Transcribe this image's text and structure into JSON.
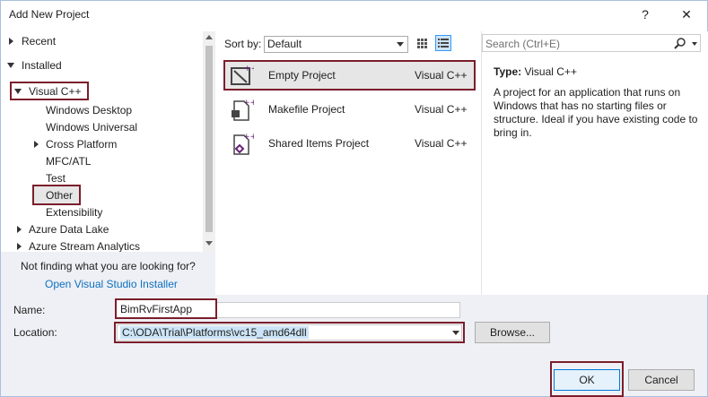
{
  "window": {
    "title": "Add New Project",
    "help": "?",
    "close": "✕"
  },
  "tree": {
    "recent": "Recent",
    "installed": "Installed",
    "visual_cpp": "Visual C++",
    "items": [
      "Windows Desktop",
      "Windows Universal",
      "Cross Platform",
      "MFC/ATL",
      "Test",
      "Other",
      "Extensibility"
    ],
    "azure_data_lake": "Azure Data Lake",
    "azure_stream": "Azure Stream Analytics"
  },
  "footer_left": {
    "message": "Not finding what you are looking for?",
    "link": "Open Visual Studio Installer"
  },
  "sort": {
    "label": "Sort by:",
    "value": "Default"
  },
  "templates": [
    {
      "name": "Empty Project",
      "language": "Visual C++"
    },
    {
      "name": "Makefile Project",
      "language": "Visual C++"
    },
    {
      "name": "Shared Items Project",
      "language": "Visual C++"
    }
  ],
  "search": {
    "placeholder": "Search (Ctrl+E)"
  },
  "details": {
    "type_label": "Type:",
    "type_value": "Visual C++",
    "description": "A project for an application that runs on Windows that has no starting files or structure. Ideal if you have existing code to bring in."
  },
  "form": {
    "name_label": "Name:",
    "name_value": "BimRvFirstApp",
    "location_label": "Location:",
    "location_value": "C:\\ODA\\Trial\\Platforms\\vc15_amd64dll",
    "browse_label": "Browse..."
  },
  "buttons": {
    "ok": "OK",
    "cancel": "Cancel"
  },
  "colors": {
    "highlight_box": "#7b1e2b",
    "link": "#0e70c0",
    "selected_row": "#e6e6e6"
  }
}
